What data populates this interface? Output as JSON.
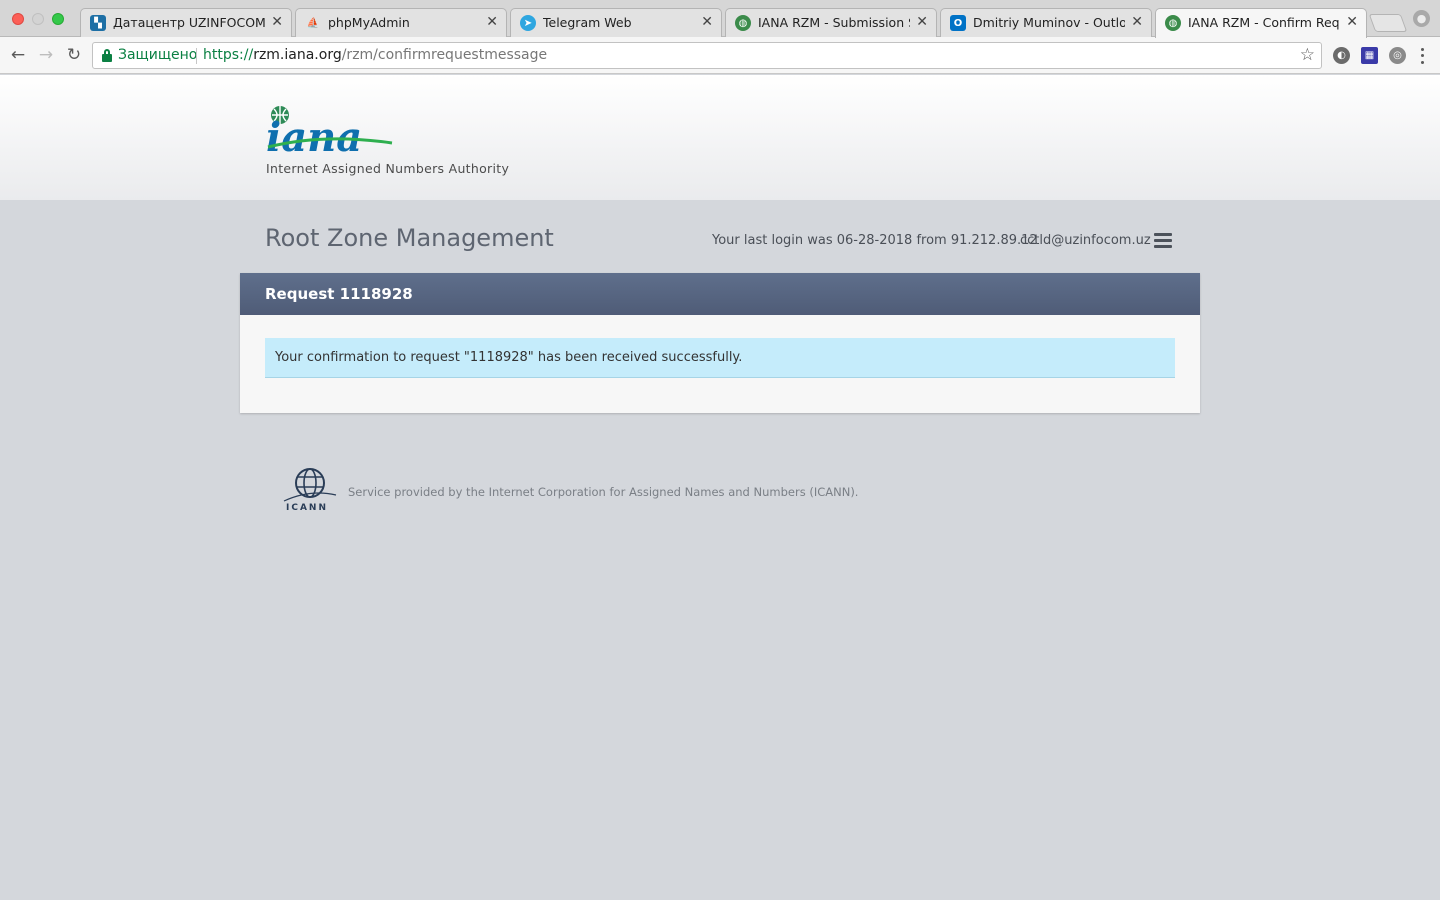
{
  "browser": {
    "tabs": [
      {
        "title": "Датацентр UZINFOCOM",
        "icon": "uzinfocom-favicon",
        "active": false
      },
      {
        "title": "phpMyAdmin",
        "icon": "phpmyadmin-favicon",
        "active": false
      },
      {
        "title": "Telegram Web",
        "icon": "telegram-favicon",
        "active": false
      },
      {
        "title": "IANA RZM - Submission Sum",
        "icon": "iana-favicon",
        "active": false
      },
      {
        "title": "Dmitriy Muminov - Outlook W",
        "icon": "outlook-favicon",
        "active": false
      },
      {
        "title": "IANA RZM - Confirm Request",
        "icon": "iana-favicon",
        "active": true
      }
    ],
    "address_bar": {
      "secure_label": "Защищено",
      "scheme": "https://",
      "host": "rzm.iana.org",
      "path": "/rzm/confirmrequestmessage"
    }
  },
  "header": {
    "logo_text": "iana",
    "subtitle": "Internet Assigned Numbers Authority"
  },
  "app": {
    "title": "Root Zone Management",
    "last_login": "Your last login was 06-28-2018 from 91.212.89.12",
    "user_email": "cctld@uzinfocom.uz"
  },
  "panel": {
    "title": "Request 1118928",
    "message": "Your confirmation to request \"1118928\" has been received successfully."
  },
  "footer": {
    "logo_text": "ICANN",
    "text": "Service provided by the Internet Corporation for Assigned Names and Numbers (ICANN)."
  },
  "colors": {
    "panel_header": "#56647f",
    "alert_bg": "#c5ecfb",
    "page_bg": "#d4d7dc",
    "secure_green": "#0b8043"
  }
}
